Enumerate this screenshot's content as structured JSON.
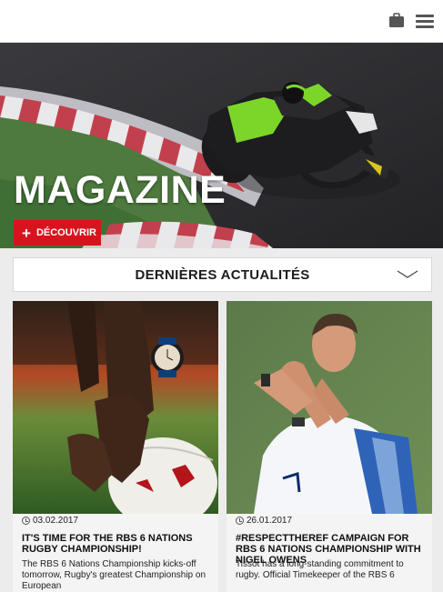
{
  "header": {
    "bag_icon": "shopping-bag-icon",
    "menu_icon": "hamburger-menu-icon"
  },
  "hero": {
    "title": "MAGAZINE",
    "cta_label": "DÉCOUVRIR",
    "cta_icon": "plus-icon",
    "colors": {
      "track": "#2d2d30",
      "curb_red": "#c2404d",
      "curb_white": "#e9e9ec",
      "grass": "#4e7a3e",
      "bike_green": "#7bd629"
    }
  },
  "news_selector": {
    "label": "DERNIÈRES ACTUALITÉS",
    "icon": "chevron-down-icon"
  },
  "articles": [
    {
      "date": "03.02.2017",
      "title": "IT'S TIME FOR THE RBS 6 NATIONS RUGBY CHAMPIONSHIP!",
      "excerpt": "The RBS 6 Nations Championship kicks-off tomorrow, Rugby's greatest Championship on European"
    },
    {
      "date": "26.01.2017",
      "title": "#RESPECTTHEREF CAMPAIGN FOR RBS 6 NATIONS CHAMPIONSHIP WITH NIGEL OWENS",
      "excerpt": "Tissot has a long-standing commitment to rugby. Official Timekeeper of the RBS 6"
    }
  ],
  "accent_color": "#d7141e"
}
